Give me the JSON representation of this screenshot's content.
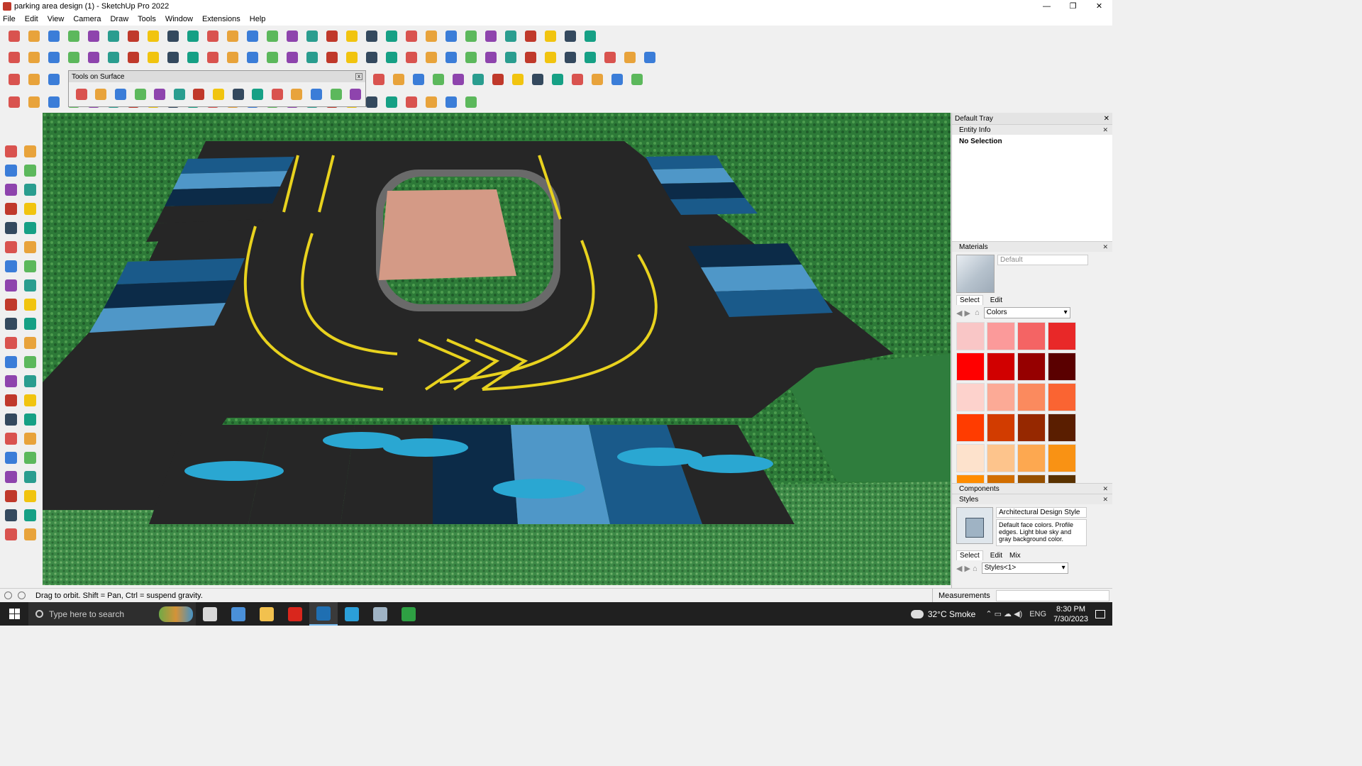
{
  "window": {
    "title": "parking area design (1) - SketchUp Pro 2022",
    "controls": [
      "—",
      "❐",
      "✕"
    ]
  },
  "menu": [
    "File",
    "Edit",
    "View",
    "Camera",
    "Draw",
    "Tools",
    "Window",
    "Extensions",
    "Help"
  ],
  "toolbar_row1_icons": [
    "zoom-icon",
    "select-icon",
    "pencil-eraser-icon",
    "line-icon",
    "arc-icon",
    "rectangle-icon",
    "push-pull-icon",
    "follow-me-icon",
    "move-icon",
    "rotate-icon",
    "scale-icon",
    "tape-measure-icon",
    "text-icon",
    "paint-bucket-icon",
    "orbit-icon",
    "pan-icon",
    "zoom-window-icon",
    "zoom-extents-icon",
    "components-icon",
    "layers-icon",
    "section-icon",
    "styles-icon",
    "walk-icon",
    "shadows-icon",
    "axes-icon",
    "xray-icon",
    "arrows-icon",
    "undo-icon",
    "redo-icon",
    "help-icon"
  ],
  "toolbar_row2_icons": [
    "camera-iso-icon",
    "top-view-icon",
    "front-view-icon",
    "right-view-icon",
    "back-view-icon",
    "left-view-icon",
    "xray-view-icon",
    "wireframe-icon",
    "hidden-line-icon",
    "shaded-icon",
    "textured-icon",
    "monochrome-icon",
    "sandbox-from-contours-icon",
    "sandbox-grid-icon",
    "smoove-icon",
    "stamp-icon",
    "drape-icon",
    "add-detail-icon",
    "flip-edge-icon",
    "warehouse-icon",
    "extension-icon",
    "house-icon",
    "building-icon",
    "home-icon",
    "garage-icon",
    "section-fill-icon",
    "section-cut-icon",
    "solid-union-icon",
    "solid-subtract-icon",
    "solid-trim-icon",
    "solid-split-icon",
    "solid-outer-icon",
    "plugin-icon"
  ],
  "toolbar_row3_icons": [
    "box-icon",
    "plane-icon",
    "pyramid-icon",
    "warning-icon",
    "curve-icon",
    "spiral-icon",
    "helix-icon",
    "joint-icon",
    "cylinder-icon",
    "magnet-icon",
    "grid-icon",
    "tile-icon",
    "tile2-icon",
    "grid3-icon",
    "close-icon",
    "circle-dots-icon",
    "array-icon"
  ],
  "toolbar_row4_icons": [
    "line-tool-icon",
    "arc-tool-icon",
    "vehicle-icon",
    "hand-icon",
    "fold-icon",
    "paper-plane-icon",
    "layers2-icon",
    "plane2-icon",
    "airplane-icon",
    "airplane2-icon",
    "airplane3-icon",
    "car-icon",
    "stairs-icon",
    "chair-icon",
    "chair2-icon",
    "pillar-icon",
    "grid-fill-icon",
    "grid-fill2-icon",
    "column-icon",
    "wheel-icon",
    "wheel2-icon",
    "ramp-icon",
    "wave-icon",
    "polygon-icon"
  ],
  "tools_on_surface": {
    "title": "Tools on Surface",
    "close": "x",
    "icons": [
      "offset-icon",
      "line-surface-icon",
      "rectangle-surface-icon",
      "circle-surface-icon",
      "polygon-surface-icon",
      "ellipse-surface-icon",
      "parallelogram-surface-icon",
      "arc-surface-icon",
      "polyline-surface-icon",
      "freehand-surface-icon",
      "select-contour-icon",
      "make-face-icon",
      "erase-contour-icon",
      "generate-faces-icon",
      "delete-faces-icon"
    ]
  },
  "left_tools": [
    "select-arrow-icon",
    "orbit-hand-icon",
    "paint-icon",
    "eraser-icon",
    "box-3d-icon",
    "tape-icon",
    "line-icon",
    "freehand-icon",
    "rectangle-icon",
    "rotated-rectangle-icon",
    "circle-icon",
    "polygon-icon",
    "arc-icon",
    "two-point-arc-icon",
    "pie-icon",
    "three-point-arc-icon",
    "move-icon",
    "push-pull-icon",
    "rotate-icon",
    "follow-me-icon",
    "scale-icon",
    "offset-icon",
    "tape-measure-icon",
    "text-icon",
    "protractor-icon",
    "dimension-icon",
    "axes-icon",
    "three-d-text-icon",
    "orbit-icon",
    "pan-icon",
    "zoom-icon",
    "zoom-window-icon",
    "zoom-extents-icon",
    "previous-view-icon",
    "position-camera-icon",
    "look-around-icon",
    "walk-icon",
    "section-plane-icon",
    "components-icon",
    "layers-icon",
    "styles-icon",
    "shadows-icon"
  ],
  "tray": {
    "title": "Default Tray",
    "entity_info": {
      "title": "Entity Info",
      "status": "No Selection"
    },
    "materials": {
      "title": "Materials",
      "name": "Default",
      "tabs": [
        "Select",
        "Edit"
      ],
      "library": "Colors",
      "swatch_colors": [
        "#f9c6c6",
        "#fb9a9a",
        "#f46464",
        "#e82828",
        "#ff0000",
        "#d10000",
        "#960000",
        "#5a0000",
        "#fdd2cc",
        "#fcaa96",
        "#fb8a5e",
        "#fa6432",
        "#ff3c00",
        "#d23c00",
        "#962800",
        "#5a1e00",
        "#fde2cc",
        "#fdc48c",
        "#fda850",
        "#f99214",
        "#ff8c00",
        "#d26e00",
        "#965000",
        "#5a3200"
      ]
    },
    "components": {
      "title": "Components"
    },
    "styles": {
      "title": "Styles",
      "name": "Architectural Design Style",
      "description": "Default face colors. Profile edges. Light blue sky and gray background color.",
      "tabs": [
        "Select",
        "Edit",
        "Mix"
      ],
      "library": "Styles<1>"
    }
  },
  "status": {
    "hint": "Drag to orbit. Shift = Pan, Ctrl = suspend gravity.",
    "measurements_label": "Measurements"
  },
  "taskbar": {
    "search_placeholder": "Type here to search",
    "weather": "32°C  Smoke",
    "language": "ENG",
    "time": "8:30 PM",
    "date": "7/30/2023",
    "apps": [
      {
        "name": "task-view-icon",
        "color": "#d8d8d8"
      },
      {
        "name": "calculator-icon",
        "color": "#4a90d9"
      },
      {
        "name": "file-explorer-icon",
        "color": "#f2c14e"
      },
      {
        "name": "acrobat-icon",
        "color": "#d9261c"
      },
      {
        "name": "sketchup-icon",
        "color": "#1f6fb2"
      },
      {
        "name": "edge-icon",
        "color": "#2b9fd9"
      },
      {
        "name": "app-window-icon",
        "color": "#9fb3c4"
      },
      {
        "name": "camtasia-icon",
        "color": "#2ea043"
      }
    ]
  },
  "colors": {
    "asphalt": "#262626",
    "lane_yellow": "#e8d21e",
    "bay_dark_blue": "#0c2b48",
    "bay_mid_blue": "#1a5a8a",
    "bay_light_blue": "#4f97c8",
    "island_pink": "#d49a86",
    "hedge": "#2b7a3a",
    "grass": "#3b8a46",
    "fish": "#2aa7d2"
  }
}
